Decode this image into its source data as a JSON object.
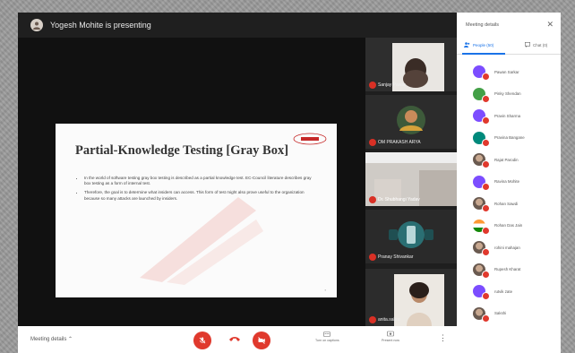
{
  "window": {
    "presenter_text": "Yogesh Mohite is presenting"
  },
  "slide": {
    "title": "Partial-Knowledge Testing [Gray Box]",
    "bullets": [
      "In the world of software testing gray box testing is described as a partial knowledge test. EC-Council literature describes gray box testing as a form of internal test.",
      "Therefore, the goal is to determine what insiders can access. This form of test might also prove useful to the organization because so many attacks are launched by insiders."
    ]
  },
  "tiles": [
    {
      "name": "Sanjay Pawar"
    },
    {
      "name": "OM PRAKASH ARYA"
    },
    {
      "name": "Dr. Shubhangi Yadav"
    },
    {
      "name": "Pranay Shivankar"
    },
    {
      "name": "anita.sabre"
    }
  ],
  "panel": {
    "title": "Meeting details",
    "close_glyph": "✕",
    "tab_people": "People (50)",
    "tab_chat": "Chat (0)",
    "people": [
      {
        "name": "Pawan Sarkar",
        "color": "#7c4dff",
        "initial": "P"
      },
      {
        "name": "Pinky Shendan",
        "color": "#43a047",
        "initial": "P"
      },
      {
        "name": "Pravin Sharma",
        "color": "#7c4dff",
        "initial": "P"
      },
      {
        "name": "Pravina Bangane",
        "color": "#00897b",
        "initial": "P"
      },
      {
        "name": "Rajat Parodin",
        "color": "#c8a890",
        "initial": ""
      },
      {
        "name": "Ravina Mohite",
        "color": "#7c4dff",
        "initial": "R"
      },
      {
        "name": "Rohan Sawdi",
        "color": "#c8a890",
        "initial": ""
      },
      {
        "name": "Rohan Das Jain",
        "color": "#43a047",
        "initial": ""
      },
      {
        "name": "rohini mahajan",
        "color": "#c8a890",
        "initial": ""
      },
      {
        "name": "Rupesh Kharat",
        "color": "#c8a890",
        "initial": ""
      },
      {
        "name": "rutvik zate",
        "color": "#7c4dff",
        "initial": "R"
      },
      {
        "name": "Sakshi",
        "color": "#c8a890",
        "initial": ""
      }
    ]
  },
  "bottombar": {
    "meeting_details": "Meeting details ⌃",
    "turn_on_captions": "Turn on captions",
    "present_now": "Present now"
  },
  "colors": {
    "accent": "#1a73e8",
    "danger": "#e0392d",
    "stage": "#111111"
  }
}
